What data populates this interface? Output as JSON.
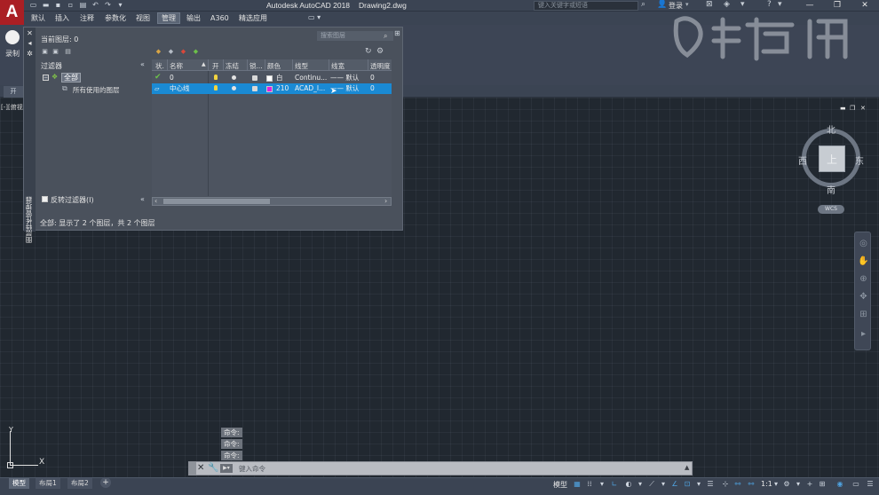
{
  "app": {
    "title": "Autodesk AutoCAD 2018",
    "file": "Drawing2.dwg",
    "logo_letter": "A",
    "search_placeholder": "键入关键字或短语",
    "login": "登录"
  },
  "ribbon": {
    "tabs": [
      "默认",
      "插入",
      "注释",
      "参数化",
      "视图",
      "管理",
      "输出",
      "A360",
      "精选应用"
    ],
    "active_tab": "管理",
    "record_label": "录制"
  },
  "viewport": {
    "label": "[-][俯视",
    "compass": {
      "north": "北",
      "south": "南",
      "east": "东",
      "west": "西",
      "top": "上"
    },
    "wcs": "WCS"
  },
  "layer_palette": {
    "title": "图层特性管理器",
    "current_layer": "当前图层: 0",
    "search_placeholder": "搜索图层",
    "filters_header": "过滤器",
    "tree": {
      "all": "全部",
      "used": "所有使用的图层"
    },
    "invert_filter": "反转过滤器(I)",
    "columns": [
      "状.",
      "名称",
      "开",
      "冻结",
      "锁...",
      "颜色",
      "线型",
      "线宽",
      "透明度"
    ],
    "layers": [
      {
        "name": "0",
        "color_name": "白",
        "color_hex": "#ffffff",
        "linetype": "Continu...",
        "lineweight": "—— 默认",
        "transparency": "0",
        "current": true,
        "selected": false
      },
      {
        "name": "中心线",
        "color_name": "210",
        "color_hex": "#e020e0",
        "linetype": "ACAD_I...",
        "lineweight": "—— 默认",
        "transparency": "0",
        "current": false,
        "selected": true
      }
    ],
    "status": "全部: 显示了 2 个图层，共 2 个图层"
  },
  "command": {
    "history": [
      "命令:",
      "命令:",
      "命令:"
    ],
    "placeholder": "键入命令"
  },
  "layout_tabs": [
    "模型",
    "布局1",
    "布局2"
  ],
  "statusbar": {
    "model": "模型",
    "scale": "1:1"
  },
  "ucs": {
    "x": "X",
    "y": "Y"
  },
  "colors": {
    "accent_select": "#1a8ad4",
    "logo_red": "#aa1f24",
    "canvas_bg": "#212830"
  }
}
